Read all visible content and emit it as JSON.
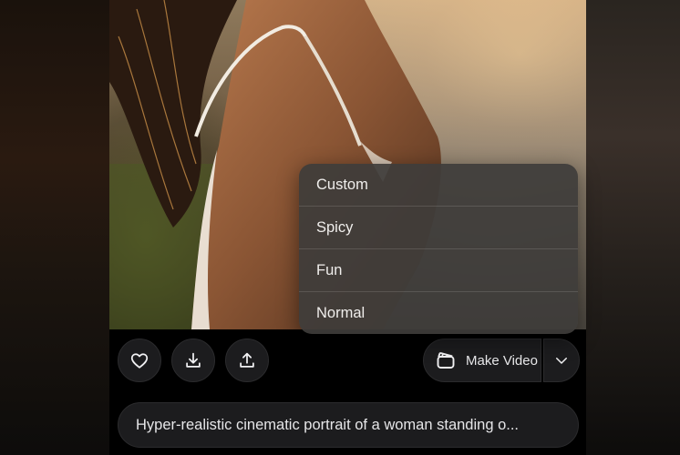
{
  "actions": {
    "like_icon": "heart-icon",
    "download_icon": "download-icon",
    "share_icon": "upload-icon",
    "make_video_label": "Make Video",
    "make_video_icon": "clapperboard-icon",
    "mode_toggle_icon": "chevron-down-icon"
  },
  "menu": {
    "items": [
      {
        "label": "Custom"
      },
      {
        "label": "Spicy"
      },
      {
        "label": "Fun"
      },
      {
        "label": "Normal"
      }
    ]
  },
  "prompt": {
    "text": "Hyper-realistic cinematic portrait of a woman standing o..."
  },
  "colors": {
    "surface": "#1c1c1e",
    "menu_background": "#3e3c3a",
    "text": "#e8e8ea"
  }
}
